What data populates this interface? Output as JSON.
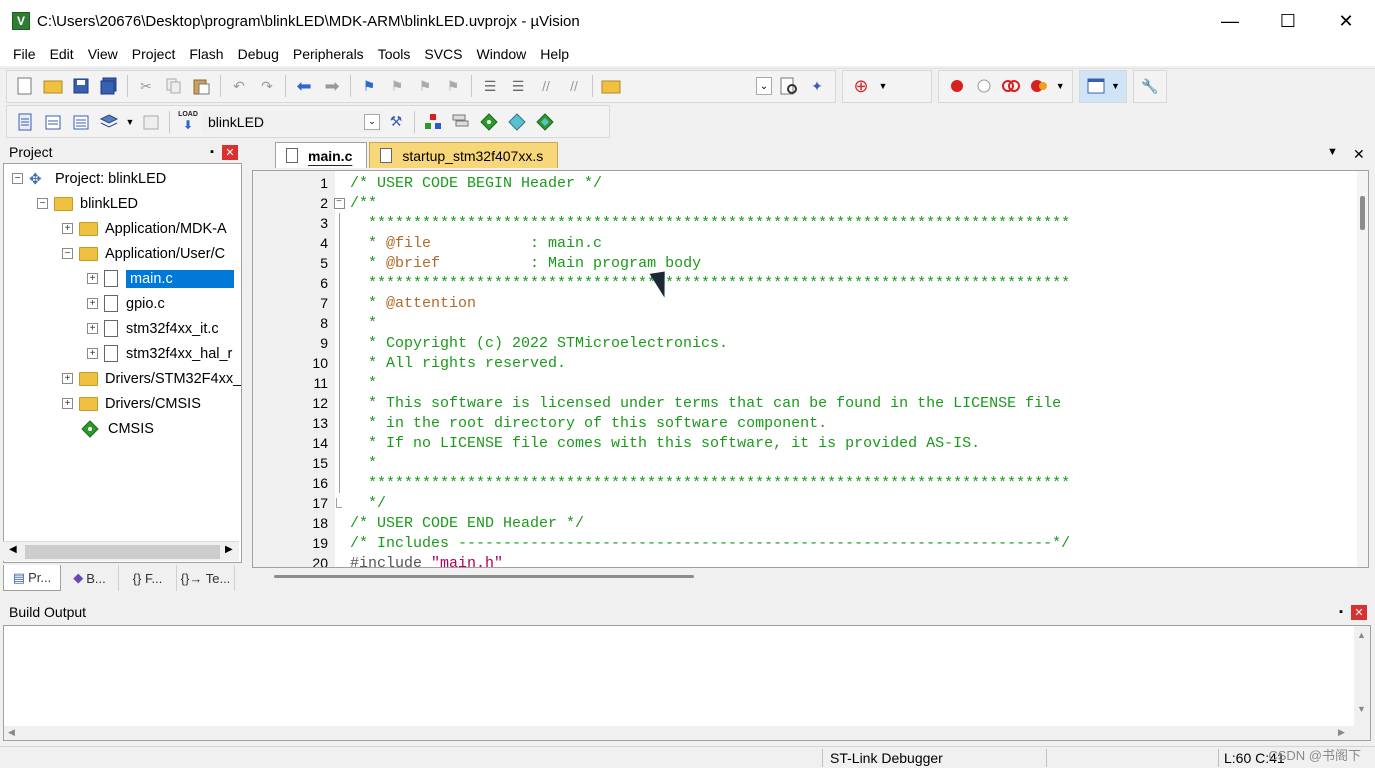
{
  "window": {
    "title": "C:\\Users\\20676\\Desktop\\program\\blinkLED\\MDK-ARM\\blinkLED.uvprojx - µVision",
    "icon_letter": "V",
    "minimize": "—",
    "maximize": "☐",
    "close": "✕"
  },
  "menu": [
    "File",
    "Edit",
    "View",
    "Project",
    "Flash",
    "Debug",
    "Peripherals",
    "Tools",
    "SVCS",
    "Window",
    "Help"
  ],
  "toolbar": {
    "target_name": "blinkLED",
    "load_label": "LOAD"
  },
  "project_panel": {
    "title": "Project",
    "pin": "📌",
    "close": "✕",
    "tree": [
      {
        "label": "Project: blinkLED",
        "level": 0,
        "kind": "project",
        "toggle": "⊟"
      },
      {
        "label": "blinkLED",
        "level": 1,
        "kind": "target",
        "toggle": "⊟"
      },
      {
        "label": "Application/MDK-A",
        "level": 2,
        "kind": "folder",
        "toggle": "⊞"
      },
      {
        "label": "Application/User/C",
        "level": 2,
        "kind": "folder",
        "toggle": "⊟"
      },
      {
        "label": "main.c",
        "level": 3,
        "kind": "file",
        "toggle": "⊞",
        "selected": true
      },
      {
        "label": "gpio.c",
        "level": 3,
        "kind": "file",
        "toggle": "⊞"
      },
      {
        "label": "stm32f4xx_it.c",
        "level": 3,
        "kind": "file",
        "toggle": "⊞"
      },
      {
        "label": "stm32f4xx_hal_r",
        "level": 3,
        "kind": "file",
        "toggle": "⊞"
      },
      {
        "label": "Drivers/STM32F4xx_",
        "level": 2,
        "kind": "folder",
        "toggle": "⊞"
      },
      {
        "label": "Drivers/CMSIS",
        "level": 2,
        "kind": "folder",
        "toggle": "⊞"
      },
      {
        "label": "CMSIS",
        "level": 2,
        "kind": "cmsis",
        "toggle": ""
      }
    ],
    "bottom_tabs": [
      {
        "label": "Pr...",
        "icon": "project-tab-icon",
        "active": true
      },
      {
        "label": "B...",
        "icon": "books-tab-icon",
        "active": false
      },
      {
        "label": "{} F...",
        "icon": "functions-tab-icon",
        "active": false
      },
      {
        "label": "{}→ Te...",
        "icon": "templates-tab-icon",
        "active": false
      }
    ]
  },
  "editor": {
    "tabs": [
      {
        "label": "main.c",
        "active": true
      },
      {
        "label": "startup_stm32f407xx.s",
        "active": false
      }
    ],
    "lines": [
      {
        "n": "1",
        "text": "/* USER CODE BEGIN Header */",
        "fold": ""
      },
      {
        "n": "2",
        "text": "/**",
        "fold": "box"
      },
      {
        "n": "3",
        "text": "  ******************************************************************************",
        "fold": "line"
      },
      {
        "n": "4",
        "text": "  * @file           : main.c",
        "fold": "line"
      },
      {
        "n": "5",
        "text": "  * @brief          : Main program body",
        "fold": "line"
      },
      {
        "n": "6",
        "text": "  ******************************************************************************",
        "fold": "line"
      },
      {
        "n": "7",
        "text": "  * @attention",
        "fold": "line"
      },
      {
        "n": "8",
        "text": "  *",
        "fold": "line"
      },
      {
        "n": "9",
        "text": "  * Copyright (c) 2022 STMicroelectronics.",
        "fold": "line"
      },
      {
        "n": "10",
        "text": "  * All rights reserved.",
        "fold": "line"
      },
      {
        "n": "11",
        "text": "  *",
        "fold": "line"
      },
      {
        "n": "12",
        "text": "  * This software is licensed under terms that can be found in the LICENSE file",
        "fold": "line"
      },
      {
        "n": "13",
        "text": "  * in the root directory of this software component.",
        "fold": "line"
      },
      {
        "n": "14",
        "text": "  * If no LICENSE file comes with this software, it is provided AS-IS.",
        "fold": "line"
      },
      {
        "n": "15",
        "text": "  *",
        "fold": "line"
      },
      {
        "n": "16",
        "text": "  ******************************************************************************",
        "fold": "line"
      },
      {
        "n": "17",
        "text": "  */",
        "fold": "end"
      },
      {
        "n": "18",
        "text": "/* USER CODE END Header */",
        "fold": ""
      },
      {
        "n": "19",
        "text": "/* Includes ------------------------------------------------------------------*/",
        "fold": ""
      },
      {
        "n": "20",
        "text": "#include \"main.h\"",
        "fold": ""
      }
    ]
  },
  "build_output": {
    "title": "Build Output"
  },
  "status": {
    "debugger": "ST-Link Debugger",
    "position": "L:60 C:41",
    "watermark": "CSDN @书阁下"
  },
  "colors": {
    "comment": "#1a9a1a",
    "doxygen_tag": "#b06a2a",
    "selection": "#0078d7",
    "inactive_tab": "#f7d77a",
    "panel_close": "#d93030"
  }
}
